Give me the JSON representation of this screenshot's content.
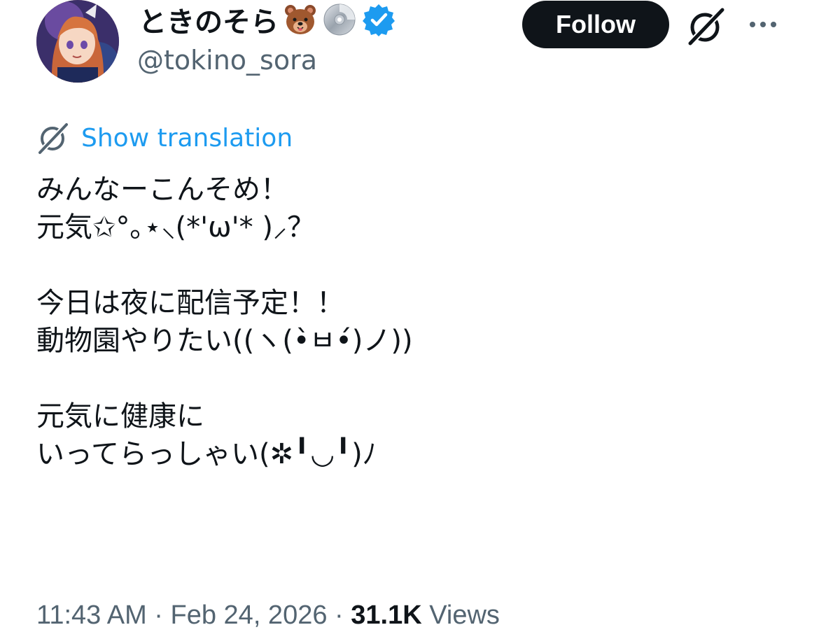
{
  "author": {
    "display_name": "ときのそら",
    "handle": "@tokino_sora",
    "name_emojis": [
      "bear-face-emoji",
      "cd-emoji"
    ],
    "verified": true
  },
  "actions": {
    "follow_label": "Follow"
  },
  "translation": {
    "label": "Show translation"
  },
  "tweet": {
    "paragraphs": [
      [
        "みんなーこんそめ！",
        "元気✩°｡⋆⸜(*'ω'* )⸝？"
      ],
      [
        "今日は夜に配信予定！！",
        "動物園やりたい((ヽ(•̀ㅂ•́)ノ))"
      ],
      [
        "元気に健康に",
        "いってらっしゃい(✲╹◡╹)ﾉ"
      ]
    ]
  },
  "meta": {
    "time": "11:43 AM",
    "separator": " · ",
    "date": "Feb 24, 2026",
    "views_count": "31.1K",
    "views_label": " Views"
  },
  "colors": {
    "text": "#0f1419",
    "secondary": "#536471",
    "accent": "#1d9bf0",
    "follow_bg": "#0f1419"
  }
}
